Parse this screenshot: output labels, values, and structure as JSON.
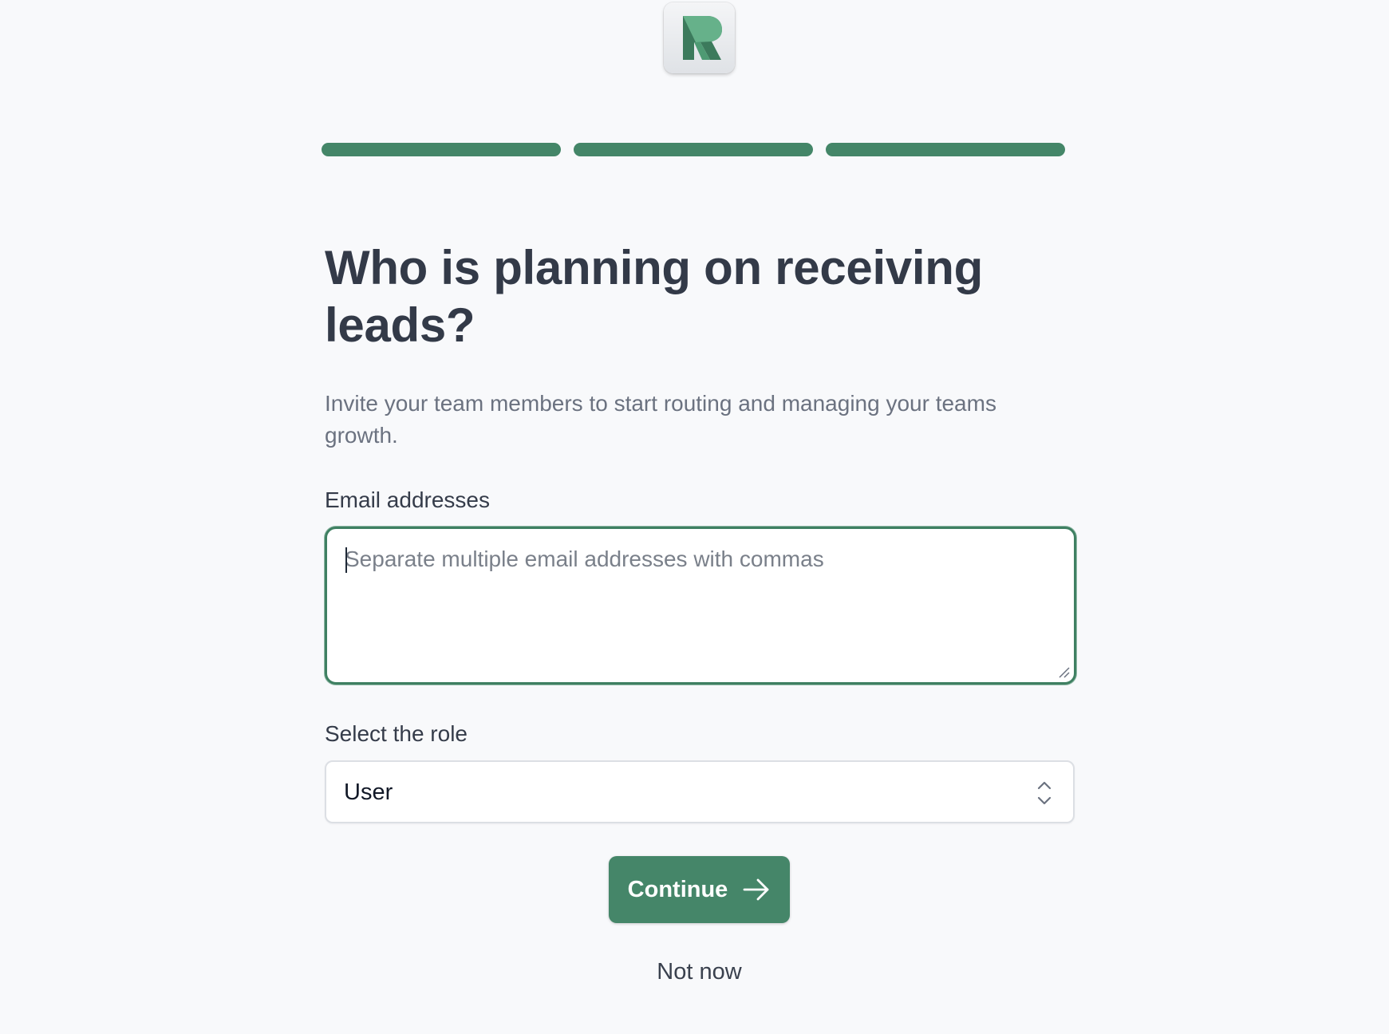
{
  "logo": {
    "icon": "r-logo-icon",
    "brand_color": "#3c7a5c"
  },
  "progress": {
    "steps_total": 3,
    "steps_completed": 3,
    "color": "#448668"
  },
  "heading": "Who is planning on receiving leads?",
  "subtitle": "Invite your team members to start routing and managing your teams growth.",
  "email_field": {
    "label": "Email addresses",
    "placeholder": "Separate multiple email addresses with commas",
    "value": ""
  },
  "role_field": {
    "label": "Select the role",
    "selected": "User"
  },
  "actions": {
    "continue_label": "Continue",
    "continue_icon": "arrow-right-icon",
    "skip_label": "Not now"
  },
  "colors": {
    "primary": "#458669",
    "background": "#f8f9fb",
    "heading": "#333a48",
    "muted_text": "#6b7280"
  }
}
